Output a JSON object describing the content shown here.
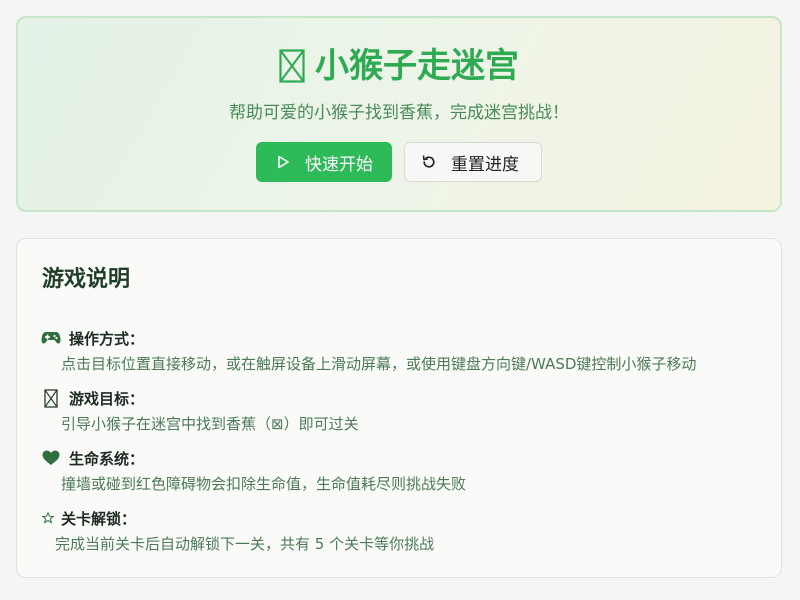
{
  "header": {
    "title": "小猴子走迷宫",
    "title_icon": "missing-glyph-icon",
    "subtitle": "帮助可爱的小猴子找到香蕉，完成迷宫挑战！",
    "start_button": {
      "label": "快速开始",
      "icon": "play-icon"
    },
    "reset_button": {
      "label": "重置进度",
      "icon": "refresh-icon"
    }
  },
  "instructions": {
    "title": "游戏说明",
    "items": [
      {
        "icon": "gamepad-icon",
        "label": "操作方式：",
        "text": "点击目标位置直接移动，或在触屏设备上滑动屏幕，或使用键盘方向键/WASD键控制小猴子移动"
      },
      {
        "icon": "missing-glyph-icon",
        "label": "游戏目标：",
        "text": "引导小猴子在迷宫中找到香蕉（⊠）即可过关"
      },
      {
        "icon": "heart-icon",
        "label": "生命系统：",
        "text": "撞墙或碰到红色障碍物会扣除生命值，生命值耗尽则挑战失败"
      },
      {
        "icon": "star-icon",
        "label": "关卡解锁：",
        "text": "完成当前关卡后自动解锁下一关，共有 5 个关卡等你挑战"
      }
    ]
  },
  "colors": {
    "accent": "#2dba58",
    "title_green": "#2eaa52",
    "text_green": "#4c7a57",
    "heart": "#2f6e3e"
  }
}
